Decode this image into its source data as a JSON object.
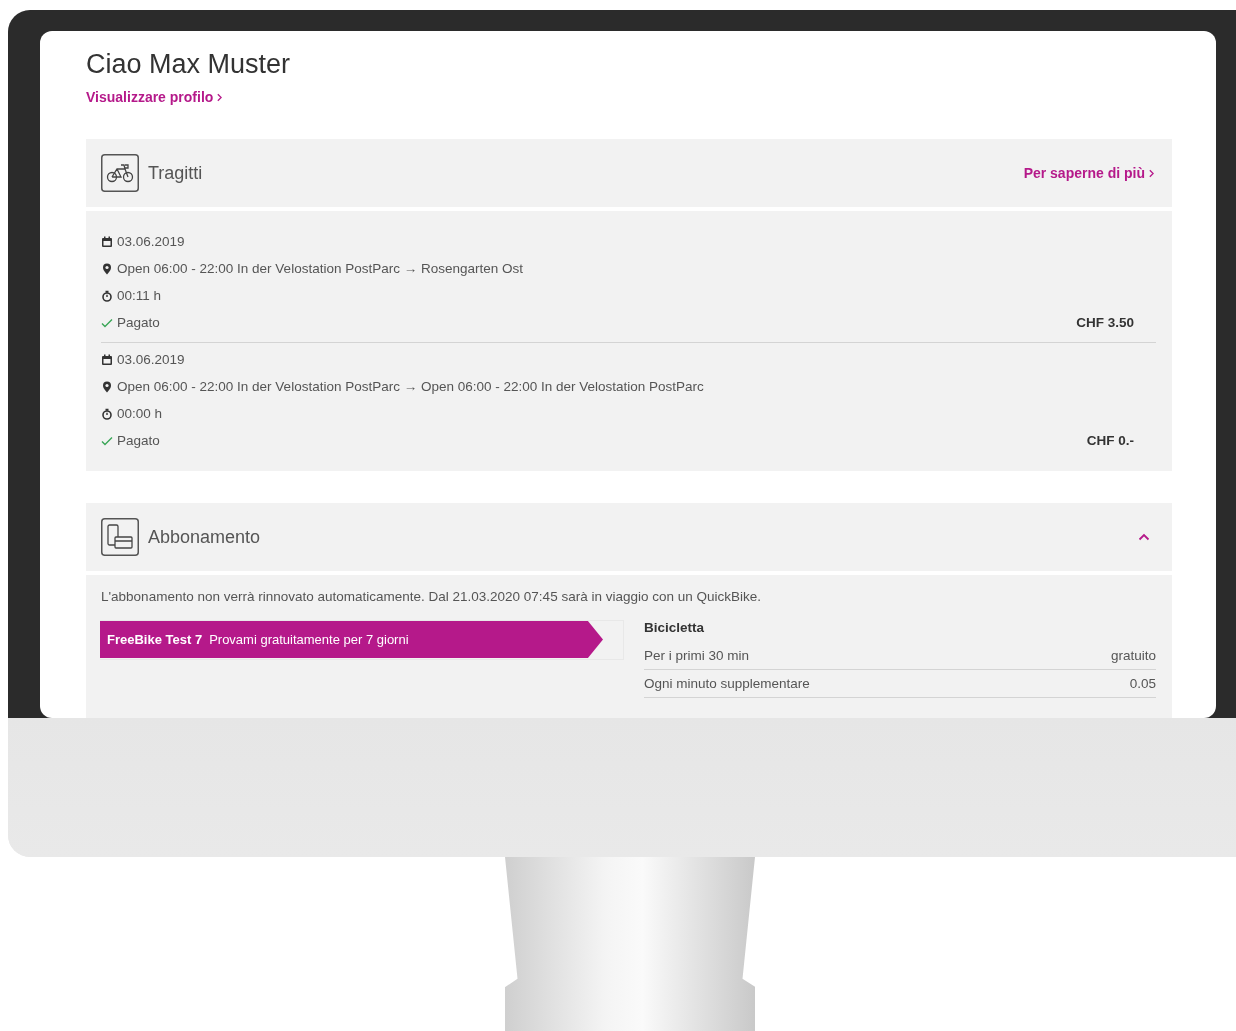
{
  "greeting": "Ciao Max Muster",
  "profile_link": "Visualizzare profilo",
  "trips": {
    "title": "Tragitti",
    "link": "Per saperne di più",
    "items": [
      {
        "date": "03.06.2019",
        "route": "Open 06:00 - 22:00 In der Velostation PostParc → Rosengarten Ost",
        "duration": "00:11 h",
        "status": "Pagato",
        "paid": true,
        "price": "CHF 3.50"
      },
      {
        "date": "03.06.2019",
        "route": "Open 06:00 - 22:00 In der Velostation PostParc → Open 06:00 - 22:00 In der Velostation PostParc",
        "duration": "00:00 h",
        "status": "Pagato",
        "paid": true,
        "price": "CHF 0.-"
      }
    ]
  },
  "subscription": {
    "title": "Abbonamento",
    "expanded": true,
    "notice": "L'abbonamento non verrà rinnovato automaticamente. Dal 21.03.2020 07:45 sarà in viaggio con un QuickBike.",
    "plan": {
      "name": "FreeBike Test 7",
      "description": "Provami gratuitamente per 7 giorni"
    },
    "tariff": {
      "title": "Bicicletta",
      "rows": [
        {
          "label": "Per i primi 30 min",
          "value": "gratuito"
        },
        {
          "label": "Ogni minuto supplementare",
          "value": "0.05"
        }
      ]
    }
  }
}
